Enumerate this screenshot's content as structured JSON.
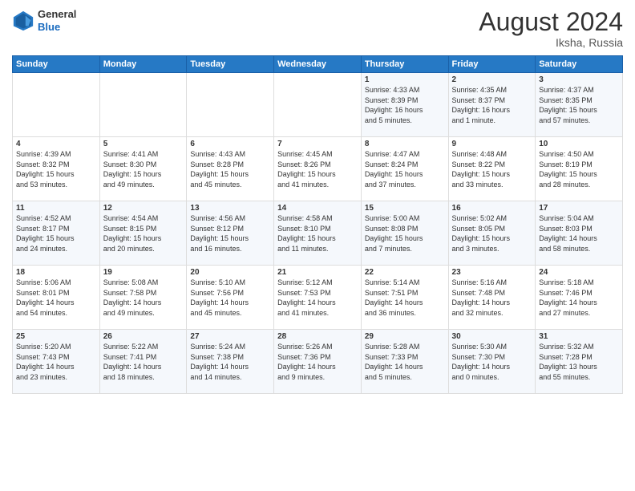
{
  "logo": {
    "general": "General",
    "blue": "Blue"
  },
  "title": "August 2024",
  "location": "Iksha, Russia",
  "days_of_week": [
    "Sunday",
    "Monday",
    "Tuesday",
    "Wednesday",
    "Thursday",
    "Friday",
    "Saturday"
  ],
  "weeks": [
    [
      {
        "day": "",
        "info": ""
      },
      {
        "day": "",
        "info": ""
      },
      {
        "day": "",
        "info": ""
      },
      {
        "day": "",
        "info": ""
      },
      {
        "day": "1",
        "info": "Sunrise: 4:33 AM\nSunset: 8:39 PM\nDaylight: 16 hours\nand 5 minutes."
      },
      {
        "day": "2",
        "info": "Sunrise: 4:35 AM\nSunset: 8:37 PM\nDaylight: 16 hours\nand 1 minute."
      },
      {
        "day": "3",
        "info": "Sunrise: 4:37 AM\nSunset: 8:35 PM\nDaylight: 15 hours\nand 57 minutes."
      }
    ],
    [
      {
        "day": "4",
        "info": "Sunrise: 4:39 AM\nSunset: 8:32 PM\nDaylight: 15 hours\nand 53 minutes."
      },
      {
        "day": "5",
        "info": "Sunrise: 4:41 AM\nSunset: 8:30 PM\nDaylight: 15 hours\nand 49 minutes."
      },
      {
        "day": "6",
        "info": "Sunrise: 4:43 AM\nSunset: 8:28 PM\nDaylight: 15 hours\nand 45 minutes."
      },
      {
        "day": "7",
        "info": "Sunrise: 4:45 AM\nSunset: 8:26 PM\nDaylight: 15 hours\nand 41 minutes."
      },
      {
        "day": "8",
        "info": "Sunrise: 4:47 AM\nSunset: 8:24 PM\nDaylight: 15 hours\nand 37 minutes."
      },
      {
        "day": "9",
        "info": "Sunrise: 4:48 AM\nSunset: 8:22 PM\nDaylight: 15 hours\nand 33 minutes."
      },
      {
        "day": "10",
        "info": "Sunrise: 4:50 AM\nSunset: 8:19 PM\nDaylight: 15 hours\nand 28 minutes."
      }
    ],
    [
      {
        "day": "11",
        "info": "Sunrise: 4:52 AM\nSunset: 8:17 PM\nDaylight: 15 hours\nand 24 minutes."
      },
      {
        "day": "12",
        "info": "Sunrise: 4:54 AM\nSunset: 8:15 PM\nDaylight: 15 hours\nand 20 minutes."
      },
      {
        "day": "13",
        "info": "Sunrise: 4:56 AM\nSunset: 8:12 PM\nDaylight: 15 hours\nand 16 minutes."
      },
      {
        "day": "14",
        "info": "Sunrise: 4:58 AM\nSunset: 8:10 PM\nDaylight: 15 hours\nand 11 minutes."
      },
      {
        "day": "15",
        "info": "Sunrise: 5:00 AM\nSunset: 8:08 PM\nDaylight: 15 hours\nand 7 minutes."
      },
      {
        "day": "16",
        "info": "Sunrise: 5:02 AM\nSunset: 8:05 PM\nDaylight: 15 hours\nand 3 minutes."
      },
      {
        "day": "17",
        "info": "Sunrise: 5:04 AM\nSunset: 8:03 PM\nDaylight: 14 hours\nand 58 minutes."
      }
    ],
    [
      {
        "day": "18",
        "info": "Sunrise: 5:06 AM\nSunset: 8:01 PM\nDaylight: 14 hours\nand 54 minutes."
      },
      {
        "day": "19",
        "info": "Sunrise: 5:08 AM\nSunset: 7:58 PM\nDaylight: 14 hours\nand 49 minutes."
      },
      {
        "day": "20",
        "info": "Sunrise: 5:10 AM\nSunset: 7:56 PM\nDaylight: 14 hours\nand 45 minutes."
      },
      {
        "day": "21",
        "info": "Sunrise: 5:12 AM\nSunset: 7:53 PM\nDaylight: 14 hours\nand 41 minutes."
      },
      {
        "day": "22",
        "info": "Sunrise: 5:14 AM\nSunset: 7:51 PM\nDaylight: 14 hours\nand 36 minutes."
      },
      {
        "day": "23",
        "info": "Sunrise: 5:16 AM\nSunset: 7:48 PM\nDaylight: 14 hours\nand 32 minutes."
      },
      {
        "day": "24",
        "info": "Sunrise: 5:18 AM\nSunset: 7:46 PM\nDaylight: 14 hours\nand 27 minutes."
      }
    ],
    [
      {
        "day": "25",
        "info": "Sunrise: 5:20 AM\nSunset: 7:43 PM\nDaylight: 14 hours\nand 23 minutes."
      },
      {
        "day": "26",
        "info": "Sunrise: 5:22 AM\nSunset: 7:41 PM\nDaylight: 14 hours\nand 18 minutes."
      },
      {
        "day": "27",
        "info": "Sunrise: 5:24 AM\nSunset: 7:38 PM\nDaylight: 14 hours\nand 14 minutes."
      },
      {
        "day": "28",
        "info": "Sunrise: 5:26 AM\nSunset: 7:36 PM\nDaylight: 14 hours\nand 9 minutes."
      },
      {
        "day": "29",
        "info": "Sunrise: 5:28 AM\nSunset: 7:33 PM\nDaylight: 14 hours\nand 5 minutes."
      },
      {
        "day": "30",
        "info": "Sunrise: 5:30 AM\nSunset: 7:30 PM\nDaylight: 14 hours\nand 0 minutes."
      },
      {
        "day": "31",
        "info": "Sunrise: 5:32 AM\nSunset: 7:28 PM\nDaylight: 13 hours\nand 55 minutes."
      }
    ]
  ]
}
